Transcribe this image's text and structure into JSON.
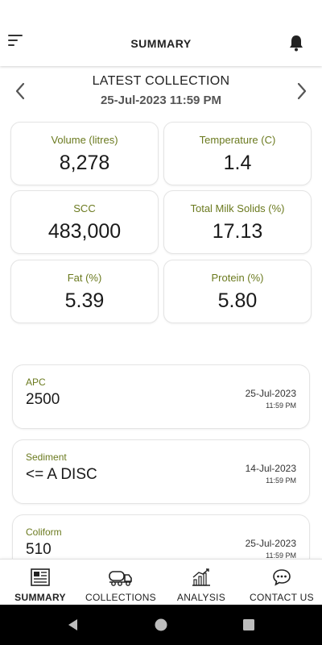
{
  "header": {
    "title": "SUMMARY"
  },
  "latest": {
    "title": "LATEST COLLECTION",
    "date": "25-Jul-2023 11:59 PM"
  },
  "metrics": [
    {
      "label": "Volume (litres)",
      "value": "8,278"
    },
    {
      "label": "Temperature (C)",
      "value": "1.4"
    },
    {
      "label": "SCC",
      "value": "483,000"
    },
    {
      "label": "Total Milk Solids (%)",
      "value": "17.13"
    },
    {
      "label": "Fat (%)",
      "value": "5.39"
    },
    {
      "label": "Protein (%)",
      "value": "5.80"
    }
  ],
  "tests": [
    {
      "label": "APC",
      "value": "2500",
      "date": "25-Jul-2023",
      "time": "11:59 PM"
    },
    {
      "label": "Sediment",
      "value": "<= A DISC",
      "date": "14-Jul-2023",
      "time": "11:59 PM"
    },
    {
      "label": "Coliform",
      "value": "510",
      "date": "25-Jul-2023",
      "time": "11:59 PM"
    }
  ],
  "nav": [
    {
      "label": "SUMMARY",
      "icon": "summary-icon",
      "active": true
    },
    {
      "label": "COLLECTIONS",
      "icon": "milk-tanker-icon",
      "active": false
    },
    {
      "label": "ANALYSIS",
      "icon": "analysis-chart-icon",
      "active": false
    },
    {
      "label": "CONTACT US",
      "icon": "chat-icon",
      "active": false
    }
  ],
  "colors": {
    "accent_label": "#6b7a1f",
    "text": "#1a1a1a",
    "android_bar": "#000000"
  }
}
